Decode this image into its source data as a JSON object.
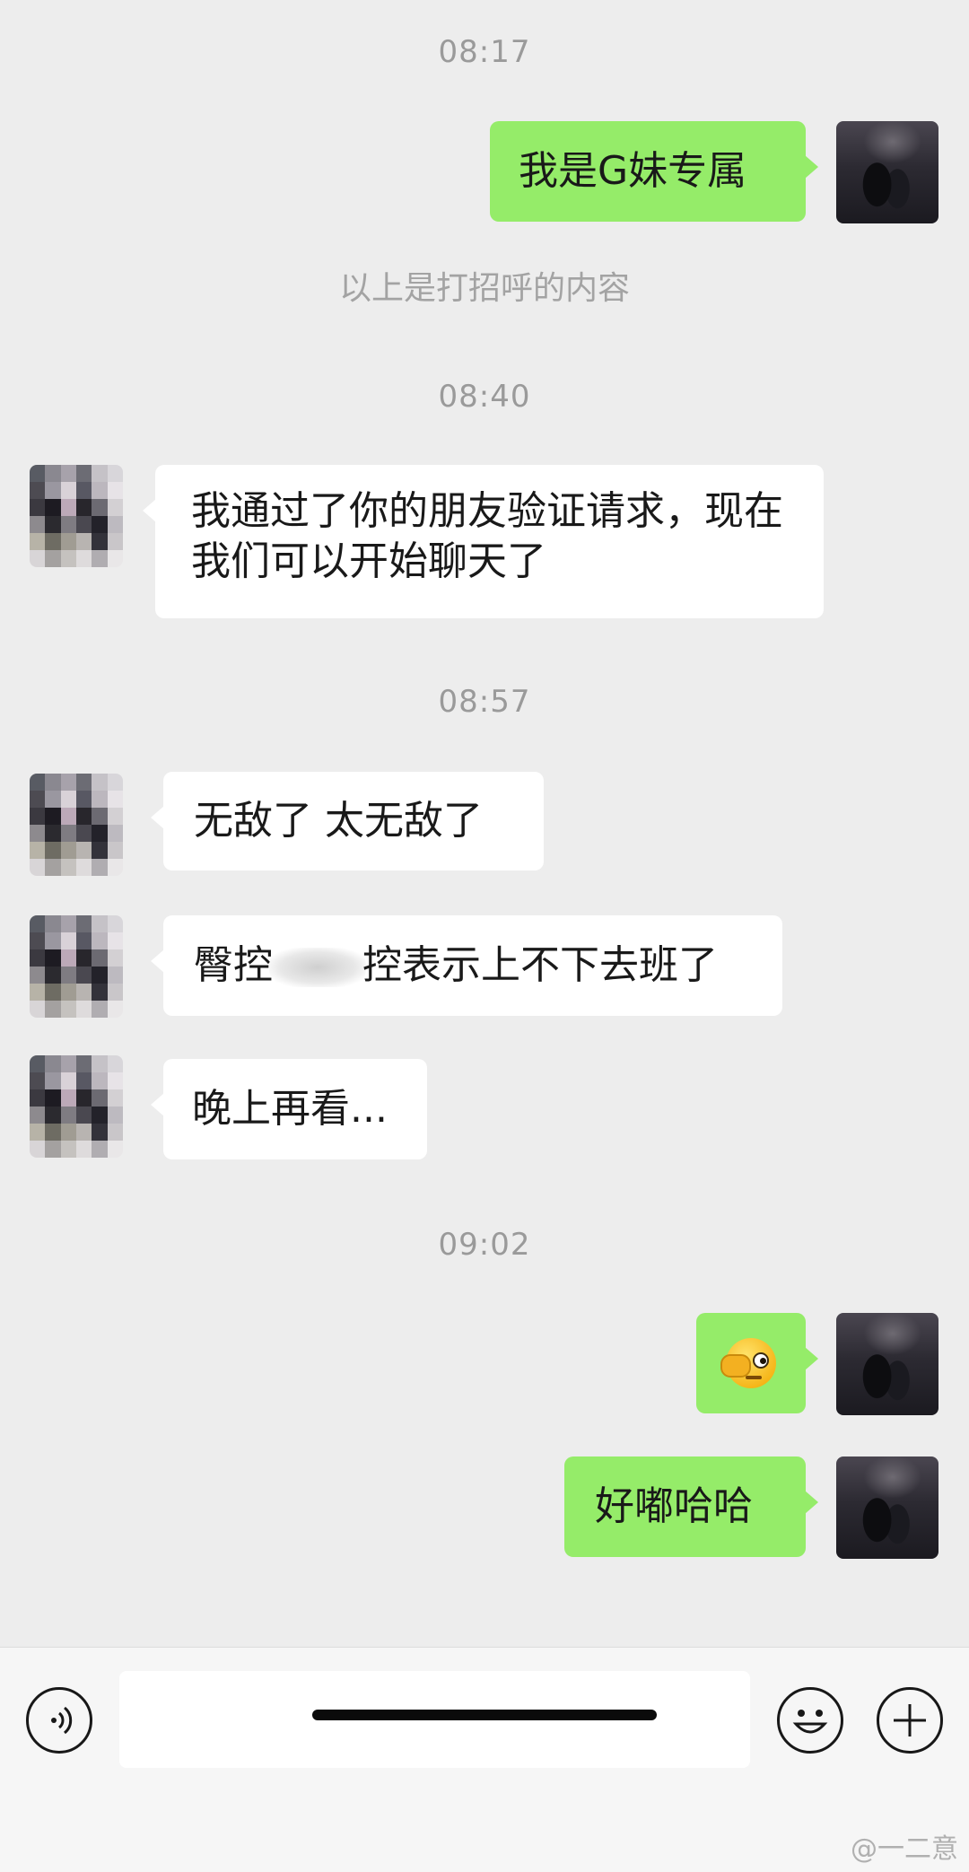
{
  "chat": {
    "time_1": "08:17",
    "msg_out_1": "我是G妹专属",
    "system_note": "以上是打招呼的内容",
    "time_2": "08:40",
    "msg_in_1": "我通过了你的朋友验证请求，现在我们可以开始聊天了",
    "time_3": "08:57",
    "msg_in_2": "无敌了 太无敌了",
    "msg_in_3_part1": "臀控",
    "msg_in_3_part2": "控表示上不下去班了",
    "msg_in_4": "晚上再看...",
    "time_4": "09:02",
    "msg_out_2_emoji": "face-with-hand-over-eye-emoji",
    "msg_out_3": "好嘟哈哈"
  },
  "input_bar": {
    "voice_icon": "voice-icon",
    "emoji_icon": "smiley-icon",
    "plus_icon": "plus-icon",
    "input_value": ""
  },
  "watermark": "@一二意",
  "colors": {
    "background": "#ededed",
    "out_bubble": "#95ec69",
    "in_bubble": "#ffffff",
    "timestamp": "#9a9a9a"
  }
}
